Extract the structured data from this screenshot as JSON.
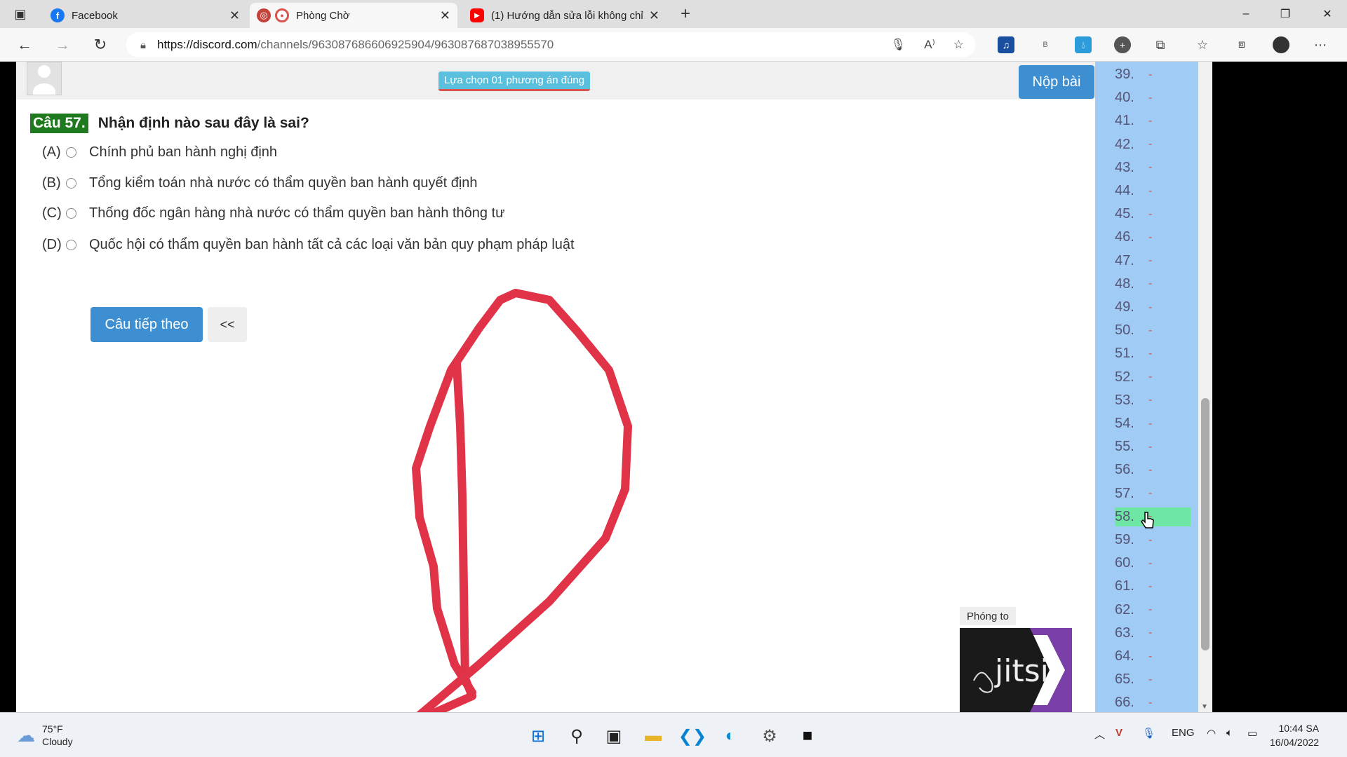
{
  "browser": {
    "tabs": [
      {
        "title": "Facebook",
        "favicon_color": "#1877f2",
        "favicon": "f"
      },
      {
        "title": "Phòng Chờ",
        "favicon_color": "#d9534f",
        "favicon": "●"
      },
      {
        "title": "(1) Hướng dẫn sửa lỗi không chỉ",
        "favicon_color": "#ff0000",
        "favicon": "▶"
      }
    ],
    "new_tab": "+",
    "url_host": "https://discord.com",
    "url_path": "/channels/963087686606925904/963087687038955570",
    "window_controls": [
      "–",
      "❐",
      "✕"
    ]
  },
  "quiz": {
    "instruction": "Lựa chọn 01 phương án đúng",
    "submit_label": "Nộp bài",
    "question_number": "Câu 57.",
    "question_text": "Nhận định nào sau đây là sai?",
    "options": [
      {
        "letter": "(A)",
        "text": "Chính phủ ban hành nghị định"
      },
      {
        "letter": "(B)",
        "text": "Tổng kiểm toán nhà nước có thẩm quyền ban hành quyết định"
      },
      {
        "letter": "(C)",
        "text": "Thống đốc ngân hàng nhà nước có thẩm quyền ban hành thông tư"
      },
      {
        "letter": "(D)",
        "text": "Quốc hội có thẩm quyền ban hành tất cả các loại văn bản quy phạm pháp luật"
      }
    ],
    "next_label": "Câu tiếp theo",
    "back_label": "<<"
  },
  "answer_sheet": {
    "rows": [
      "39.",
      "40.",
      "41.",
      "42.",
      "43.",
      "44.",
      "45.",
      "46.",
      "47.",
      "48.",
      "49.",
      "50.",
      "51.",
      "52.",
      "53.",
      "54.",
      "55.",
      "56.",
      "57.",
      "58.",
      "59.",
      "60.",
      "61.",
      "62.",
      "63.",
      "64.",
      "65.",
      "66."
    ],
    "dash": "-",
    "current": "58."
  },
  "jitsi": {
    "label": "Phóng to",
    "brand": "jitsi"
  },
  "taskbar": {
    "temperature": "75°F",
    "condition": "Cloudy",
    "language": "ENG",
    "time": "10:44 SA",
    "date": "16/04/2022"
  }
}
